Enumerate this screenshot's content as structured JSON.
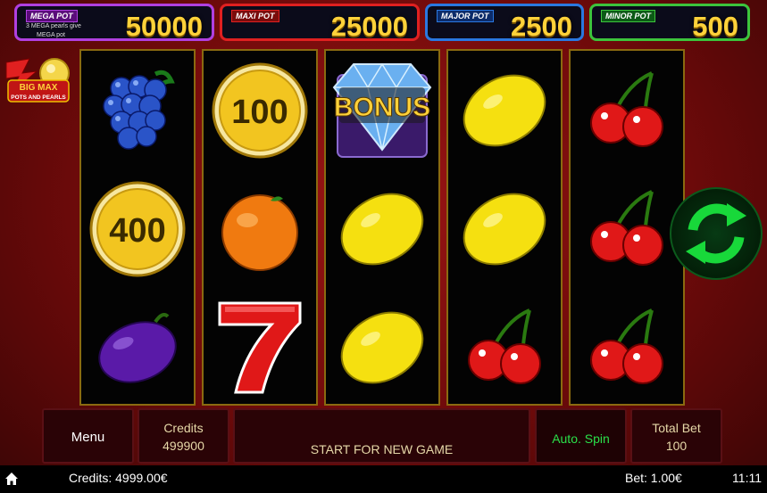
{
  "jackpots": [
    {
      "label": "MEGA POT",
      "value": "50000",
      "note1": "3 MEGA pearls give",
      "note2": "MEGA pot",
      "color": "#b040e0"
    },
    {
      "label": "MAXI POT",
      "value": "25000",
      "color": "#e02020"
    },
    {
      "label": "MAJOR POT",
      "value": "2500",
      "color": "#2a78e0"
    },
    {
      "label": "MINOR POT",
      "value": "500",
      "color": "#3cc43c"
    }
  ],
  "logo": {
    "line1": "BIG MAX",
    "line2": "POTS AND PEARLS"
  },
  "reels": [
    [
      "grapes",
      "coin-400",
      "plum"
    ],
    [
      "coin-100",
      "orange",
      "seven"
    ],
    [
      "bonus-diamond",
      "lemon",
      "lemon"
    ],
    [
      "lemon",
      "lemon",
      "cherries"
    ],
    [
      "cherries",
      "cherries",
      "cherries"
    ]
  ],
  "coins": {
    "c100": "100",
    "c400": "400"
  },
  "bonus_label": "BONUS",
  "controls": {
    "menu": "Menu",
    "credits_label": "Credits",
    "credits_value": "499900",
    "message": "START FOR NEW GAME",
    "auto_spin": "Auto. Spin",
    "total_bet_label": "Total Bet",
    "total_bet_value": "100"
  },
  "status_bar": {
    "credits": "Credits: 4999.00€",
    "bet": "Bet: 1.00€",
    "time": "11:11"
  }
}
